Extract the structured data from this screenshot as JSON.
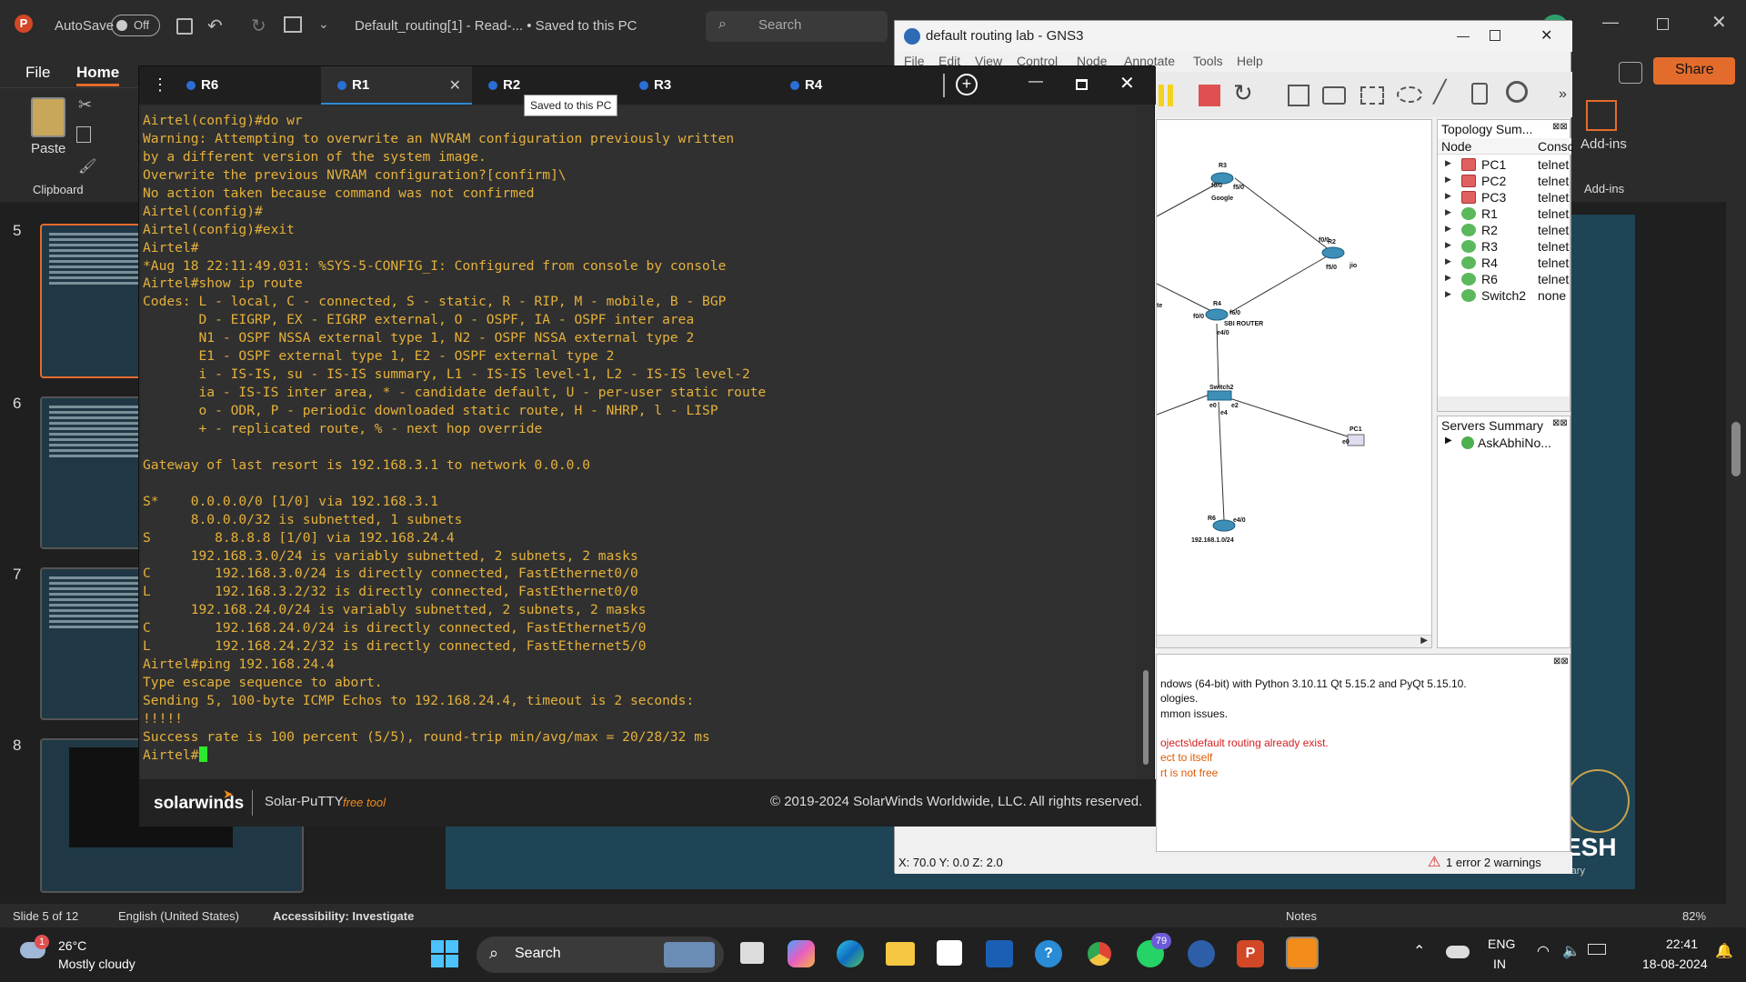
{
  "powerpoint": {
    "autosave_label": "AutoSave",
    "autosave_state": "Off",
    "doc_title": "Default_routing[1]  -  Read-...  •  Saved to this PC",
    "search_placeholder": "Search",
    "menu": [
      "File",
      "Home"
    ],
    "share_label": "Share",
    "paste_label": "Paste",
    "clipboard_label": "Clipboard",
    "addins_label": "Add-ins",
    "addins_group_label": "Add-ins",
    "slide_numbers": [
      "5",
      "6",
      "7",
      "8"
    ],
    "status": {
      "slide": "Slide 5 of 12",
      "language": "English (United States)",
      "accessibility": "Accessibility: Investigate",
      "notes": "Notes",
      "zoom": "82%"
    },
    "slide_brand_text": "ESH",
    "slide_brand_sub": "rary"
  },
  "gns3": {
    "title": "default routing lab - GNS3",
    "menu": [
      "File",
      "Edit",
      "View",
      "Control",
      "Node",
      "Annotate",
      "Tools",
      "Help"
    ],
    "topology_title": "Topology Sum...",
    "col_node": "Node",
    "col_console": "Consc",
    "nodes": [
      {
        "name": "PC1",
        "console": "telnet",
        "status": "red"
      },
      {
        "name": "PC2",
        "console": "telnet",
        "status": "red"
      },
      {
        "name": "PC3",
        "console": "telnet",
        "status": "red"
      },
      {
        "name": "R1",
        "console": "telnet",
        "status": "green"
      },
      {
        "name": "R2",
        "console": "telnet",
        "status": "green"
      },
      {
        "name": "R3",
        "console": "telnet",
        "status": "green"
      },
      {
        "name": "R4",
        "console": "telnet",
        "status": "green"
      },
      {
        "name": "R6",
        "console": "telnet",
        "status": "green"
      },
      {
        "name": "Switch2",
        "console": "none",
        "status": "green"
      }
    ],
    "servers_title": "Servers Summary",
    "server": "AskAbhiNo...",
    "console_lines": [
      {
        "text": "ndows (64-bit) with Python 3.10.11 Qt 5.15.2 and PyQt 5.15.10.",
        "color": "#111111"
      },
      {
        "text": "ologies.",
        "color": "#111111"
      },
      {
        "text": "mmon issues.",
        "color": "#111111"
      },
      {
        "text": "",
        "color": "#111111"
      },
      {
        "text": "ojects\\default routing already exist.",
        "color": "#d62020"
      },
      {
        "text": "ect to itself",
        "color": "#e05a00"
      },
      {
        "text": "rt is not free",
        "color": "#e05a00"
      }
    ],
    "status_coords": "X: 70.0 Y: 0.0 Z: 2.0",
    "status_errors": "1 error 2 warnings",
    "topology_labels": {
      "r3": "R3",
      "google": "Google",
      "r3_f00": "f0/0",
      "r3_f50": "f5/0",
      "r2_f00": "f0/0",
      "r2": "R2",
      "r2_f50": "f5/0",
      "jio": "jio",
      "r4": "R4",
      "r4_f00": "f0/0",
      "r4_f60": "f6/0",
      "sbi": "SBI ROUTER",
      "r4_e40": "e4/0",
      "switch": "Switch2",
      "sw_e0": "e0",
      "sw_e2": "e2",
      "sw_e4": "e4",
      "pc1": "PC1",
      "pc1_e0": "e0",
      "r6": "R6",
      "r6_e40": "e4/0",
      "r6_net": "192.168.1.0/24",
      "cut_te": "te"
    }
  },
  "putty": {
    "tabs": [
      {
        "label": "R6",
        "active": false
      },
      {
        "label": "R1",
        "active": true
      },
      {
        "label": "R2",
        "active": false
      },
      {
        "label": "R3",
        "active": false
      },
      {
        "label": "R4",
        "active": false
      }
    ],
    "tooltip": "Saved to this PC",
    "terminal_lines": [
      "Airtel(config)#do wr",
      "Warning: Attempting to overwrite an NVRAM configuration previously written",
      "by a different version of the system image.",
      "Overwrite the previous NVRAM configuration?[confirm]\\",
      "No action taken because command was not confirmed",
      "Airtel(config)#",
      "Airtel(config)#exit",
      "Airtel#",
      "*Aug 18 22:11:49.031: %SYS-5-CONFIG_I: Configured from console by console",
      "Airtel#show ip route",
      "Codes: L - local, C - connected, S - static, R - RIP, M - mobile, B - BGP",
      "       D - EIGRP, EX - EIGRP external, O - OSPF, IA - OSPF inter area",
      "       N1 - OSPF NSSA external type 1, N2 - OSPF NSSA external type 2",
      "       E1 - OSPF external type 1, E2 - OSPF external type 2",
      "       i - IS-IS, su - IS-IS summary, L1 - IS-IS level-1, L2 - IS-IS level-2",
      "       ia - IS-IS inter area, * - candidate default, U - per-user static route",
      "       o - ODR, P - periodic downloaded static route, H - NHRP, l - LISP",
      "       + - replicated route, % - next hop override",
      "",
      "Gateway of last resort is 192.168.3.1 to network 0.0.0.0",
      "",
      "S*    0.0.0.0/0 [1/0] via 192.168.3.1",
      "      8.0.0.0/32 is subnetted, 1 subnets",
      "S        8.8.8.8 [1/0] via 192.168.24.4",
      "      192.168.3.0/24 is variably subnetted, 2 subnets, 2 masks",
      "C        192.168.3.0/24 is directly connected, FastEthernet0/0",
      "L        192.168.3.2/32 is directly connected, FastEthernet0/0",
      "      192.168.24.0/24 is variably subnetted, 2 subnets, 2 masks",
      "C        192.168.24.0/24 is directly connected, FastEthernet5/0",
      "L        192.168.24.2/32 is directly connected, FastEthernet5/0",
      "Airtel#ping 192.168.24.4",
      "Type escape sequence to abort.",
      "Sending 5, 100-byte ICMP Echos to 192.168.24.4, timeout is 2 seconds:",
      "!!!!!",
      "Success rate is 100 percent (5/5), round-trip min/avg/max = 20/28/32 ms"
    ],
    "prompt": "Airtel#",
    "brand": "solarwinds",
    "product": "Solar-PuTTY",
    "product_tag": "free tool",
    "copyright": "© 2019-2024 SolarWinds Worldwide, LLC. All rights reserved."
  },
  "taskbar": {
    "weather_temp": "26°C",
    "weather_desc": "Mostly cloudy",
    "weather_badge": "1",
    "search_label": "Search",
    "whatsapp_badge": "79",
    "lang_top": "ENG",
    "lang_bottom": "IN",
    "time": "22:41",
    "date": "18-08-2024"
  }
}
